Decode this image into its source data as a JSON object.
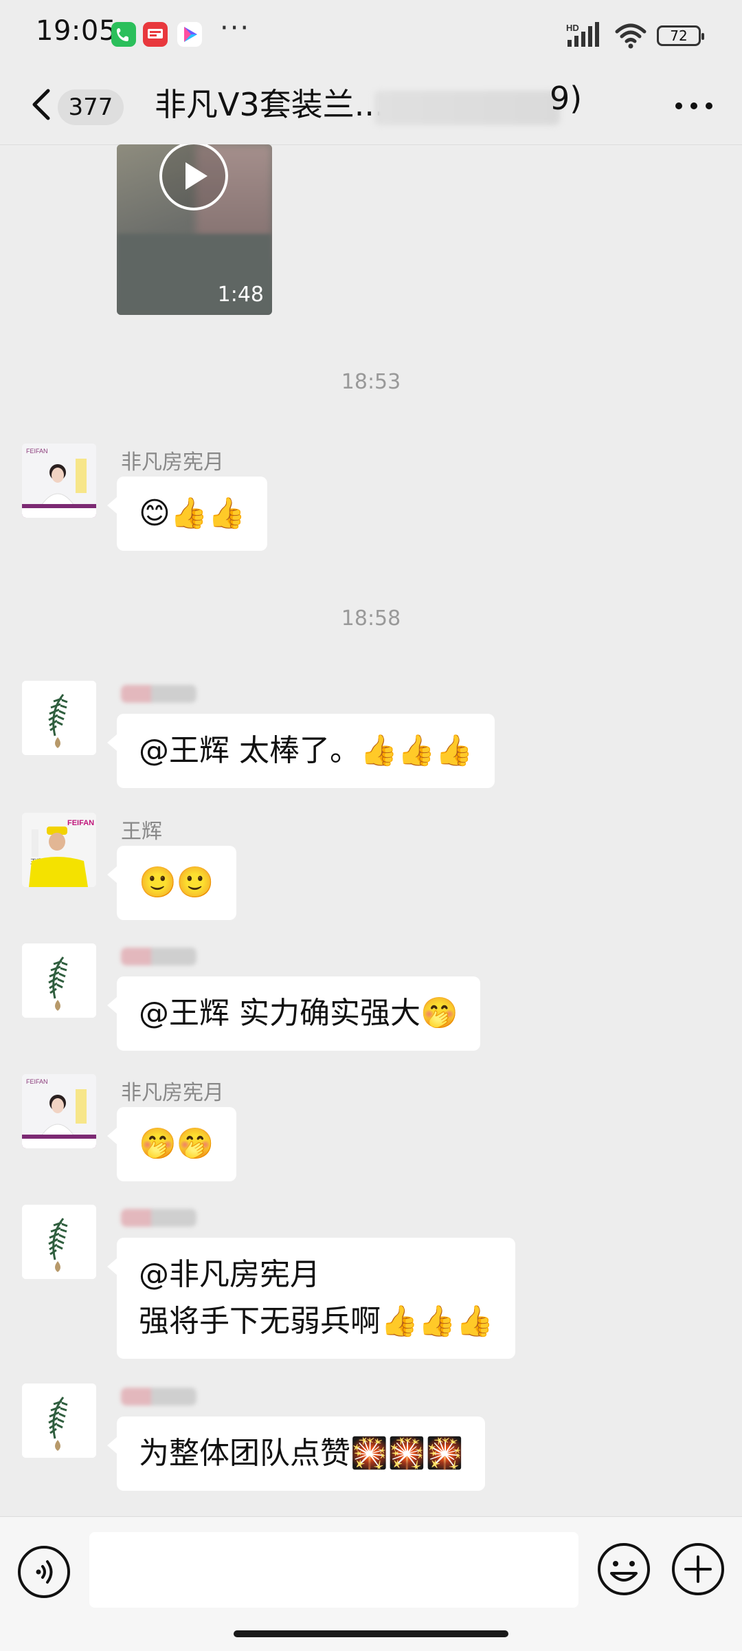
{
  "status_bar": {
    "time": "19:05",
    "more": "···",
    "network": "HD",
    "battery": "72"
  },
  "header": {
    "unread_count": "377",
    "title": "非凡V3套装兰...",
    "title_suffix": "9)"
  },
  "video": {
    "duration": "1:48"
  },
  "timestamps": [
    "18:53",
    "18:58"
  ],
  "messages": [
    {
      "sender": "非凡房宪月",
      "text": "😊👍👍"
    },
    {
      "sender": "",
      "text": "@王辉  太棒了。👍👍👍"
    },
    {
      "sender": "王辉",
      "text": "🙂🙂"
    },
    {
      "sender": "",
      "text": "@王辉  实力确实强大🤭"
    },
    {
      "sender": "非凡房宪月",
      "text": "🤭🤭"
    },
    {
      "sender": "",
      "text": "@非凡房宪月\n强将手下无弱兵啊👍👍👍"
    },
    {
      "sender": "",
      "text": "为整体团队点赞🎇🎇🎇"
    }
  ],
  "avatar_text": {
    "brand": "FEIFAN",
    "name_tag": "王辉"
  },
  "colors": {
    "background": "#ededed",
    "bubble": "#ffffff",
    "timestamp": "#999999",
    "sender": "#888888"
  }
}
